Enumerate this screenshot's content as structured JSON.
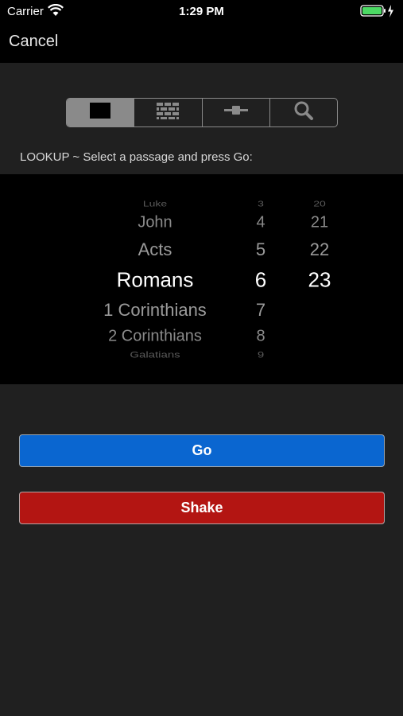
{
  "status_bar": {
    "carrier": "Carrier",
    "time": "1:29 PM",
    "wifi_icon": "wifi-icon",
    "battery_icon": "battery-charging-icon"
  },
  "nav": {
    "cancel_label": "Cancel"
  },
  "segments": [
    {
      "icon": "square-icon",
      "selected": true
    },
    {
      "icon": "brick-wall-icon",
      "selected": false
    },
    {
      "icon": "slider-icon",
      "selected": false
    },
    {
      "icon": "search-icon",
      "selected": false
    }
  ],
  "prompt": "LOOKUP ~ Select a passage and press Go:",
  "picker": {
    "books": [
      "Luke",
      "John",
      "Acts",
      "Romans",
      "1 Corinthians",
      "2 Corinthians",
      "Galatians"
    ],
    "book_selected": "Romans",
    "chapters": [
      "3",
      "4",
      "5",
      "6",
      "7",
      "8",
      "9"
    ],
    "chapter_selected": "6",
    "verses": [
      "20",
      "21",
      "22",
      "23"
    ],
    "verse_selected": "23"
  },
  "buttons": {
    "go_label": "Go",
    "shake_label": "Shake"
  },
  "colors": {
    "go": "#0a66d0",
    "shake": "#b31512",
    "background": "#202020"
  }
}
